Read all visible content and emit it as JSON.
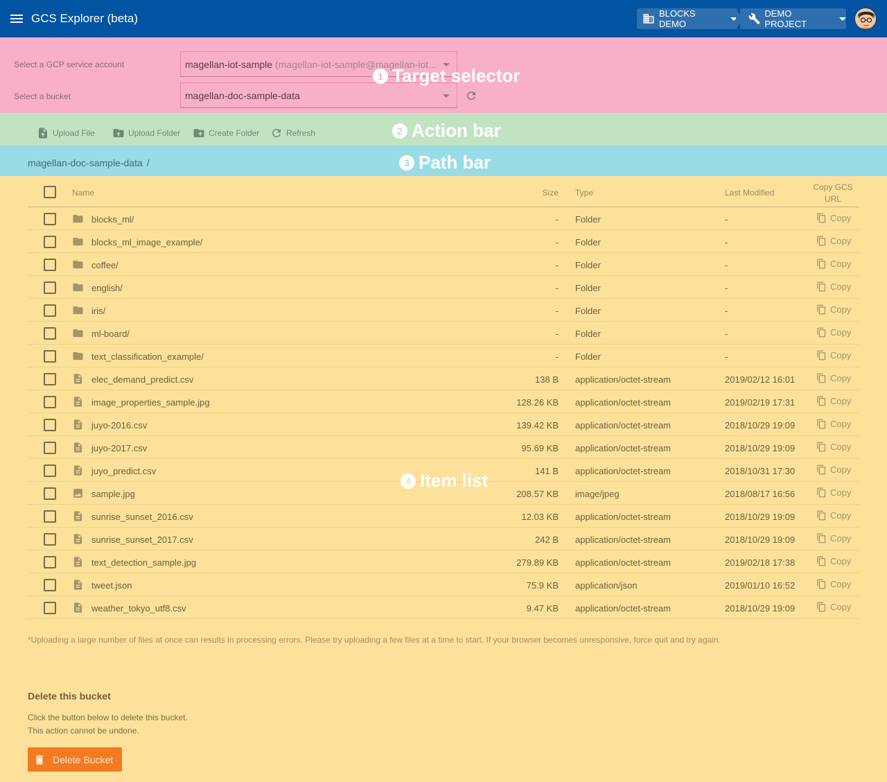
{
  "header": {
    "title": "GCS Explorer (beta)",
    "organization": "BLOCKS DEMO",
    "project": "DEMO PROJECT",
    "color": "#0054a1"
  },
  "sections": {
    "target": {
      "num": "1",
      "label": "Target selector"
    },
    "action": {
      "num": "2",
      "label": "Action bar"
    },
    "path": {
      "num": "3",
      "label": "Path bar"
    },
    "items": {
      "num": "4",
      "label": "Item list"
    }
  },
  "selector": {
    "account_label": "Select a GCP service account",
    "account_value": "magellan-iot-sample",
    "account_detail": "(magellan-iot-sample@magellan-iot...",
    "bucket_label": "Select a bucket",
    "bucket_value": "magellan-doc-sample-data"
  },
  "actions": {
    "upload_file": "Upload File",
    "upload_folder": "Upload Folder",
    "create_folder": "Create Folder",
    "refresh": "Refresh"
  },
  "path": {
    "bucket": "magellan-doc-sample-data",
    "separator": "/"
  },
  "table": {
    "headers": {
      "name": "Name",
      "size": "Size",
      "type": "Type",
      "modified": "Last Modified",
      "copy_line1": "Copy GCS",
      "copy_line2": "URL"
    },
    "copy_label": "Copy",
    "rows": [
      {
        "icon": "folder-icon",
        "name": "blocks_ml/",
        "size": "-",
        "type": "Folder",
        "modified": "-"
      },
      {
        "icon": "folder-icon",
        "name": "blocks_ml_image_example/",
        "size": "-",
        "type": "Folder",
        "modified": "-"
      },
      {
        "icon": "folder-icon",
        "name": "coffee/",
        "size": "-",
        "type": "Folder",
        "modified": "-"
      },
      {
        "icon": "folder-icon",
        "name": "english/",
        "size": "-",
        "type": "Folder",
        "modified": "-"
      },
      {
        "icon": "folder-icon",
        "name": "iris/",
        "size": "-",
        "type": "Folder",
        "modified": "-"
      },
      {
        "icon": "folder-icon",
        "name": "ml-board/",
        "size": "-",
        "type": "Folder",
        "modified": "-"
      },
      {
        "icon": "folder-icon",
        "name": "text_classification_example/",
        "size": "-",
        "type": "Folder",
        "modified": "-"
      },
      {
        "icon": "file-icon",
        "name": "elec_demand_predict.csv",
        "size": "138 B",
        "type": "application/octet-stream",
        "modified": "2019/02/12 16:01"
      },
      {
        "icon": "file-icon",
        "name": "image_properties_sample.jpg",
        "size": "128.26 KB",
        "type": "application/octet-stream",
        "modified": "2019/02/19 17:31"
      },
      {
        "icon": "file-icon",
        "name": "juyo-2016.csv",
        "size": "139.42 KB",
        "type": "application/octet-stream",
        "modified": "2018/10/29 19:09"
      },
      {
        "icon": "file-icon",
        "name": "juyo-2017.csv",
        "size": "95.69 KB",
        "type": "application/octet-stream",
        "modified": "2018/10/29 19:09"
      },
      {
        "icon": "file-icon",
        "name": "juyo_predict.csv",
        "size": "141 B",
        "type": "application/octet-stream",
        "modified": "2018/10/31 17:30"
      },
      {
        "icon": "image-icon",
        "name": "sample.jpg",
        "size": "208.57 KB",
        "type": "image/jpeg",
        "modified": "2018/08/17 16:56"
      },
      {
        "icon": "file-icon",
        "name": "sunrise_sunset_2016.csv",
        "size": "12.03 KB",
        "type": "application/octet-stream",
        "modified": "2018/10/29 19:09"
      },
      {
        "icon": "file-icon",
        "name": "sunrise_sunset_2017.csv",
        "size": "242 B",
        "type": "application/octet-stream",
        "modified": "2018/10/29 19:09"
      },
      {
        "icon": "file-icon",
        "name": "text_detection_sample.jpg",
        "size": "279.89 KB",
        "type": "application/octet-stream",
        "modified": "2019/02/18 17:38"
      },
      {
        "icon": "file-icon",
        "name": "tweet.json",
        "size": "75.9 KB",
        "type": "application/json",
        "modified": "2019/01/10 16:52"
      },
      {
        "icon": "file-icon",
        "name": "weather_tokyo_utf8.csv",
        "size": "9.47 KB",
        "type": "application/octet-stream",
        "modified": "2018/10/29 19:09"
      }
    ]
  },
  "note": "*Uploading a large number of files at once can results in processing errors. Please try uploading a few files at a time to start. If your browser becomes unresponsive, force quit and try again.",
  "delete": {
    "title": "Delete this bucket",
    "desc_line1": "Click the button below to delete this bucket.",
    "desc_line2": "This action cannot be undone.",
    "button": "Delete Bucket",
    "color": "#f47a20"
  }
}
